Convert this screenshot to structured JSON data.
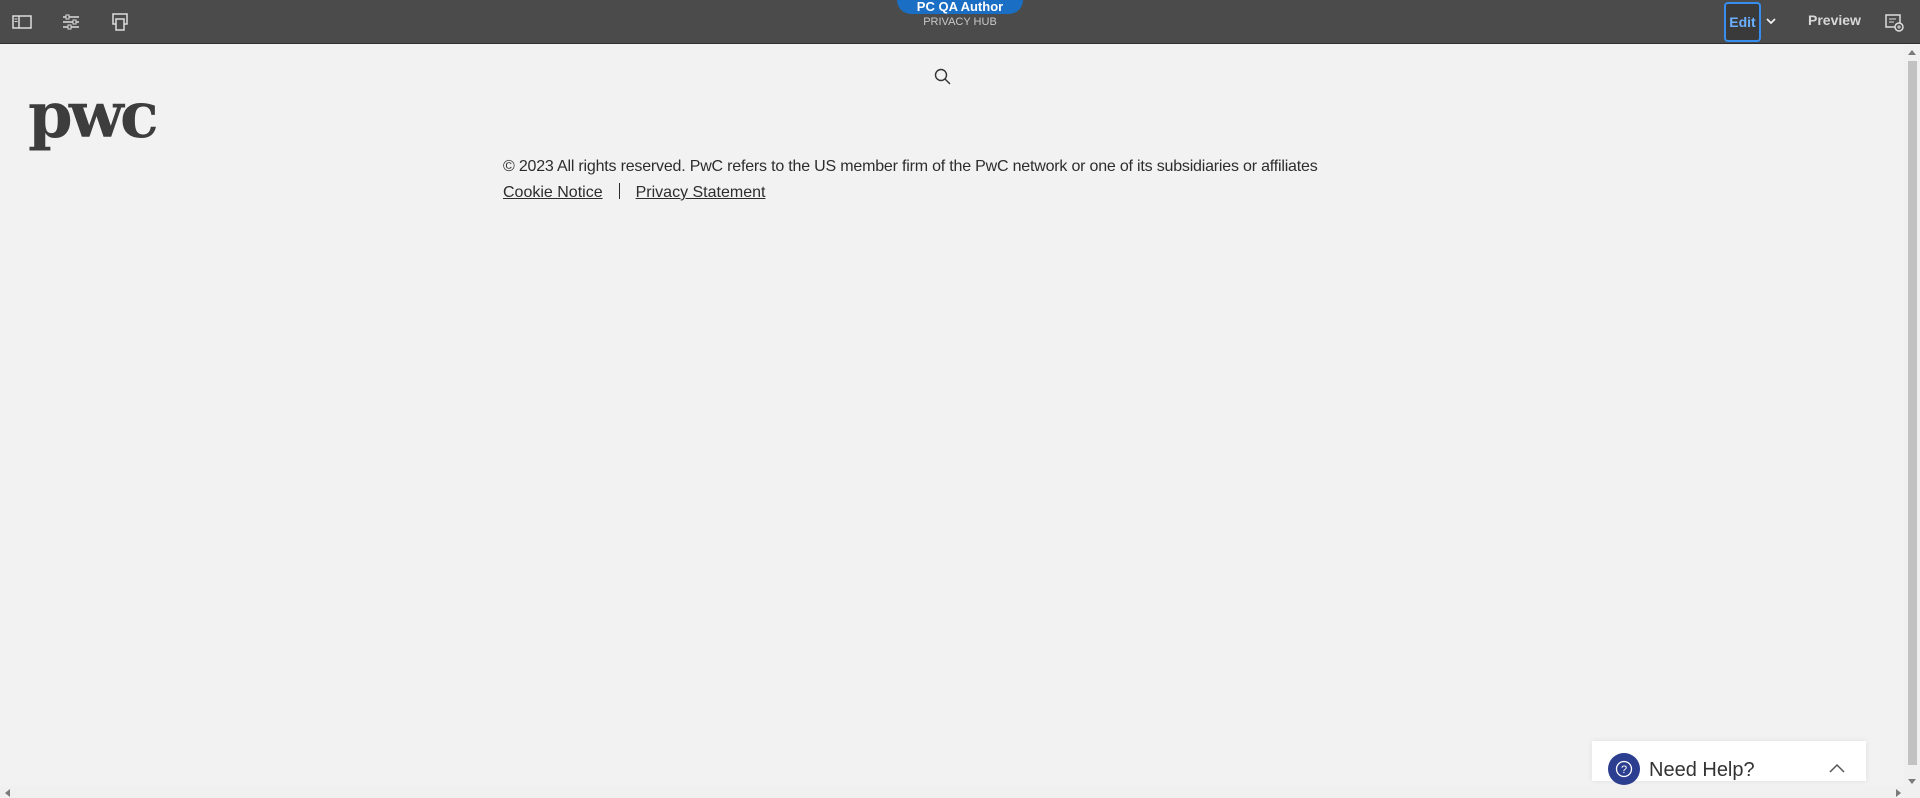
{
  "toolbar": {
    "title": "PC QA Author",
    "subtitle": "PRIVACY HUB",
    "edit_label": "Edit",
    "preview_label": "Preview",
    "icons": [
      "side-panel-icon",
      "page-properties-icon",
      "emulator-icon",
      "chevron-down-icon",
      "annotations-icon"
    ],
    "accent_color": "#1a6fc4"
  },
  "page": {
    "logo_alt": "pwc",
    "copyright": "© 2023 All rights reserved. PwC refers to the US member firm of the PwC network or one of its subsidiaries or affiliates",
    "links": {
      "cookie": "Cookie Notice",
      "privacy": "Privacy Statement"
    }
  },
  "help_widget": {
    "label": "Need Help?",
    "color": "#2c3e8f"
  }
}
